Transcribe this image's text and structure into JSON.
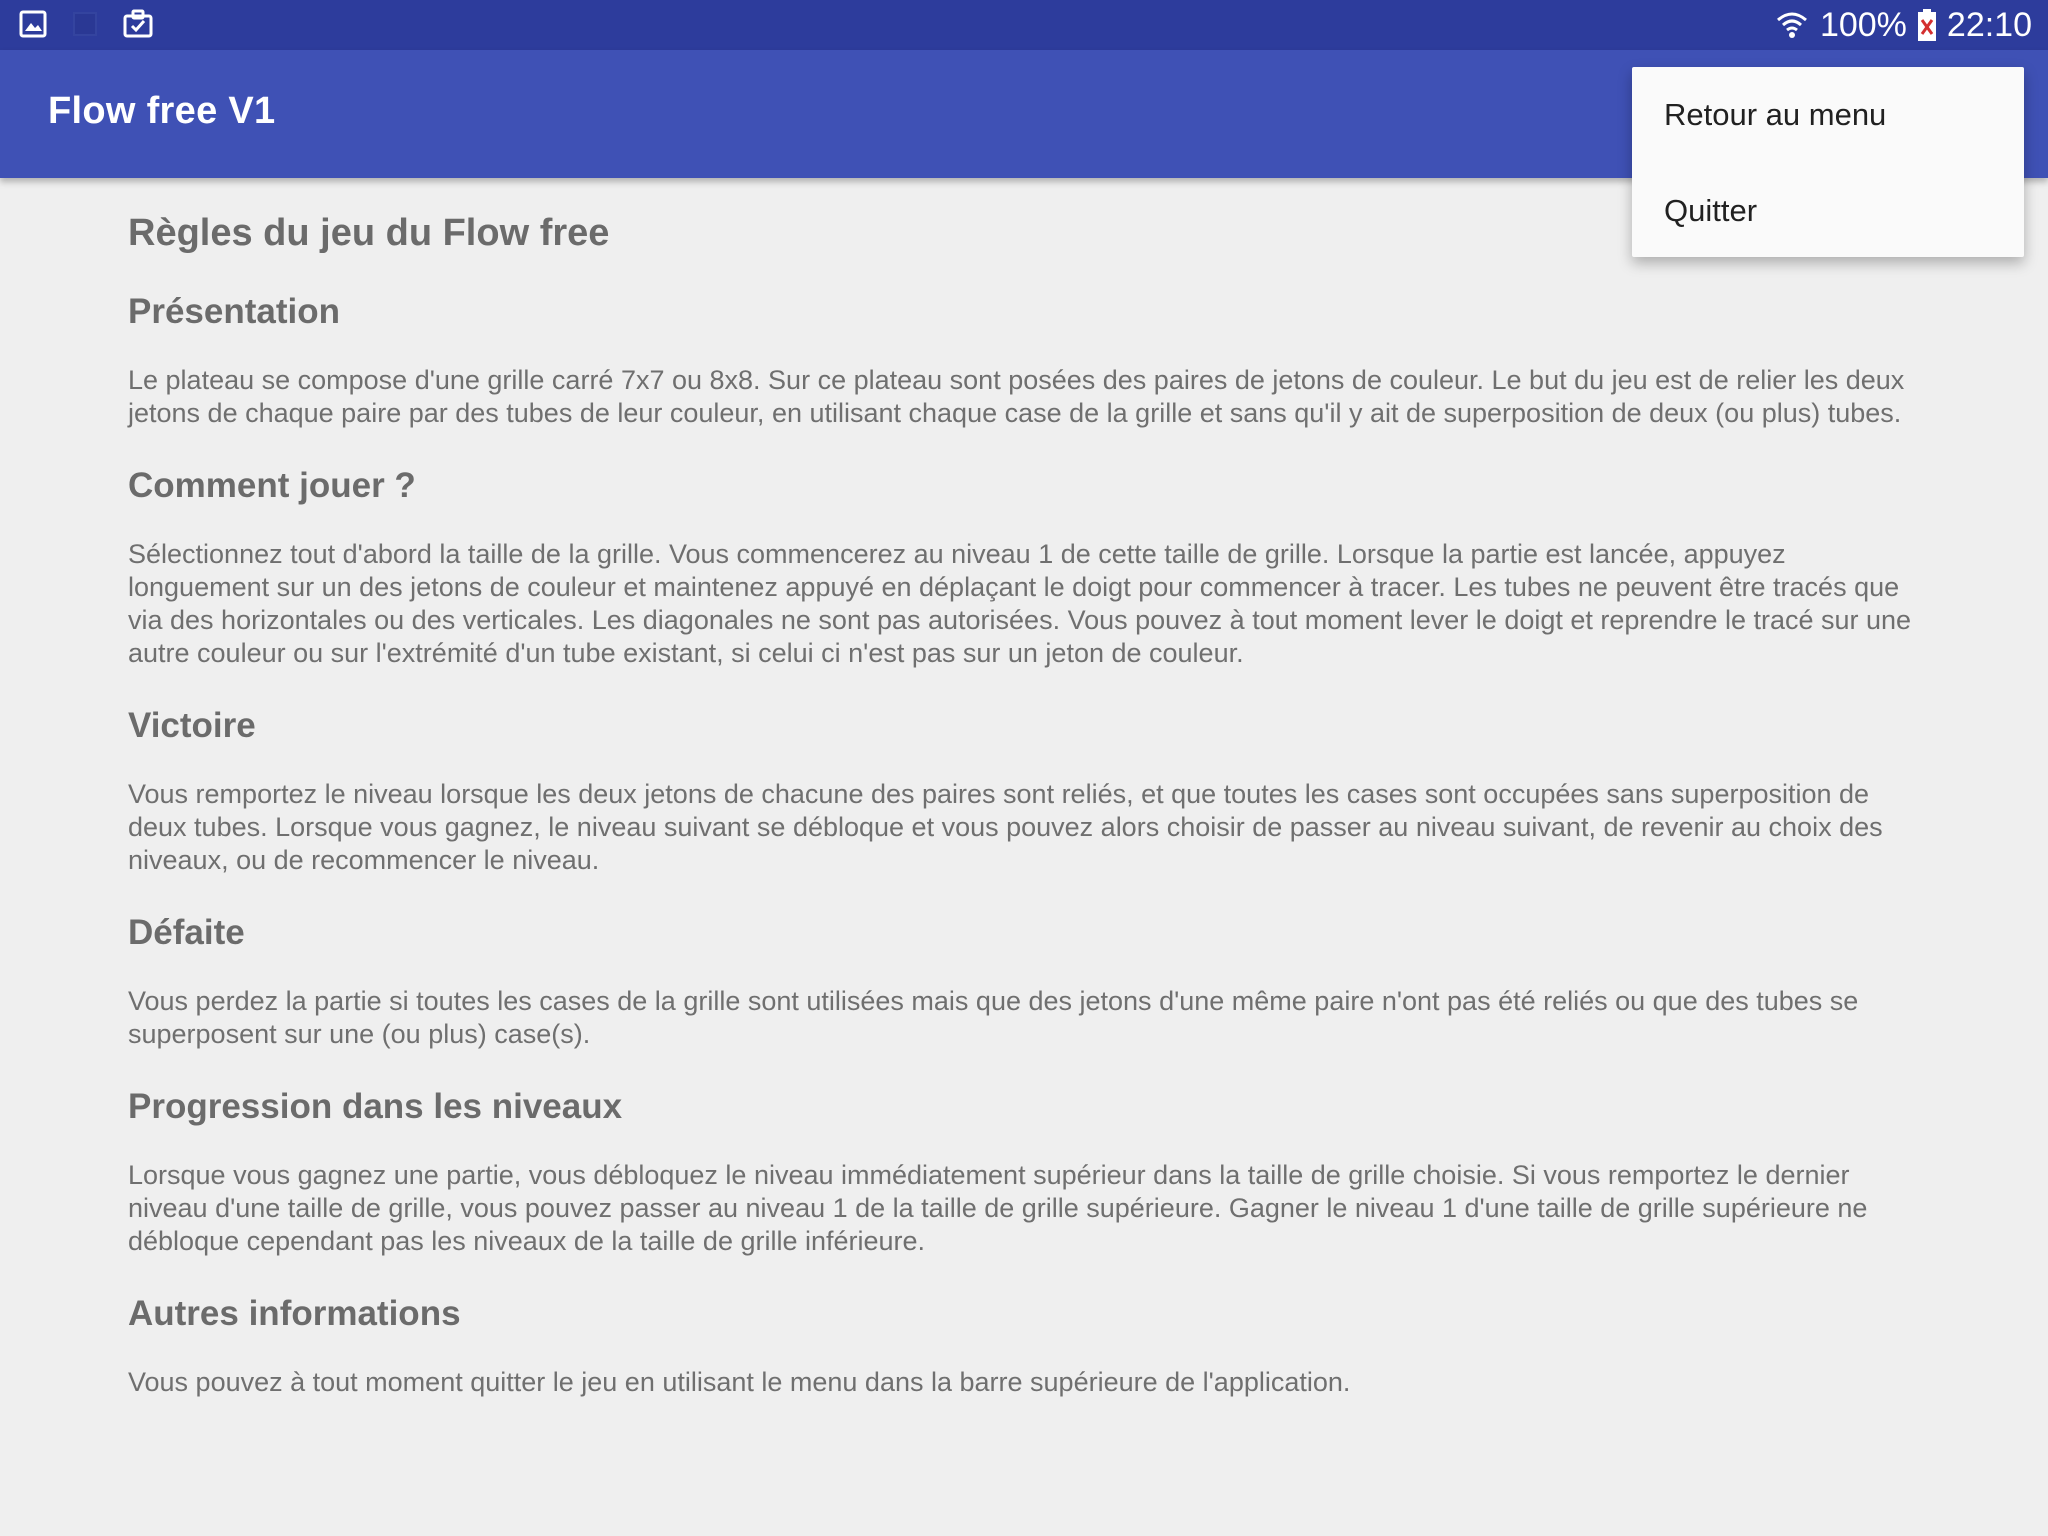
{
  "status_bar": {
    "icons_left": [
      "gallery-icon",
      "blank-notification-icon",
      "clipboard-check-icon"
    ],
    "battery_percent": "100%",
    "time": "22:10",
    "icons_right": [
      "wifi-icon",
      "battery-icon"
    ]
  },
  "app_bar": {
    "title": "Flow free V1"
  },
  "overflow_menu": {
    "items": [
      {
        "label": "Retour au menu"
      },
      {
        "label": "Quitter"
      }
    ]
  },
  "content": {
    "title": "Règles du jeu du Flow free",
    "sections": [
      {
        "heading": "Présentation",
        "text": "Le plateau se compose d'une grille carré 7x7 ou 8x8. Sur ce plateau sont posées des paires de jetons de couleur. Le but du jeu est de relier les deux jetons de chaque paire par des tubes de leur couleur, en utilisant chaque case de la grille et sans qu'il y ait de superposition de deux (ou plus) tubes."
      },
      {
        "heading": "Comment jouer ?",
        "text": "Sélectionnez tout d'abord la taille de la grille. Vous commencerez au niveau 1 de cette taille de grille. Lorsque la partie est lancée, appuyez longuement sur un des jetons de couleur et maintenez appuyé en déplaçant le doigt pour commencer à tracer. Les tubes ne peuvent être tracés que via des horizontales ou des verticales. Les diagonales ne sont pas autorisées. Vous pouvez à tout moment lever le doigt et reprendre le tracé sur une autre couleur ou sur l'extrémité d'un tube existant, si celui ci n'est pas sur un jeton de couleur."
      },
      {
        "heading": "Victoire",
        "text": "Vous remportez le niveau lorsque les deux jetons de chacune des paires sont reliés, et que toutes les cases sont occupées sans superposition de deux tubes. Lorsque vous gagnez, le niveau suivant se débloque et vous pouvez alors choisir de passer au niveau suivant, de revenir au choix des niveaux, ou de recommencer le niveau."
      },
      {
        "heading": "Défaite",
        "text": "Vous perdez la partie si toutes les cases de la grille sont utilisées mais que des jetons d'une même paire n'ont pas été reliés ou que des tubes se superposent sur une (ou plus) case(s)."
      },
      {
        "heading": "Progression dans les niveaux",
        "text": "Lorsque vous gagnez une partie, vous débloquez le niveau immédiatement supérieur dans la taille de grille choisie. Si vous remportez le dernier niveau d'une taille de grille, vous pouvez passer au niveau 1 de la taille de grille supérieure. Gagner le niveau 1 d'une taille de grille supérieure ne débloque cependant pas les niveaux de la taille de grille inférieure."
      },
      {
        "heading": "Autres informations",
        "text": "Vous pouvez à tout moment quitter le jeu en utilisant le menu dans la barre supérieure de l'application."
      }
    ]
  },
  "colors": {
    "status_bar": "#2d3c9c",
    "app_bar": "#3f51b5",
    "background": "#efefef",
    "text": "#6f6f6f",
    "menu_bg": "#fafafa"
  }
}
